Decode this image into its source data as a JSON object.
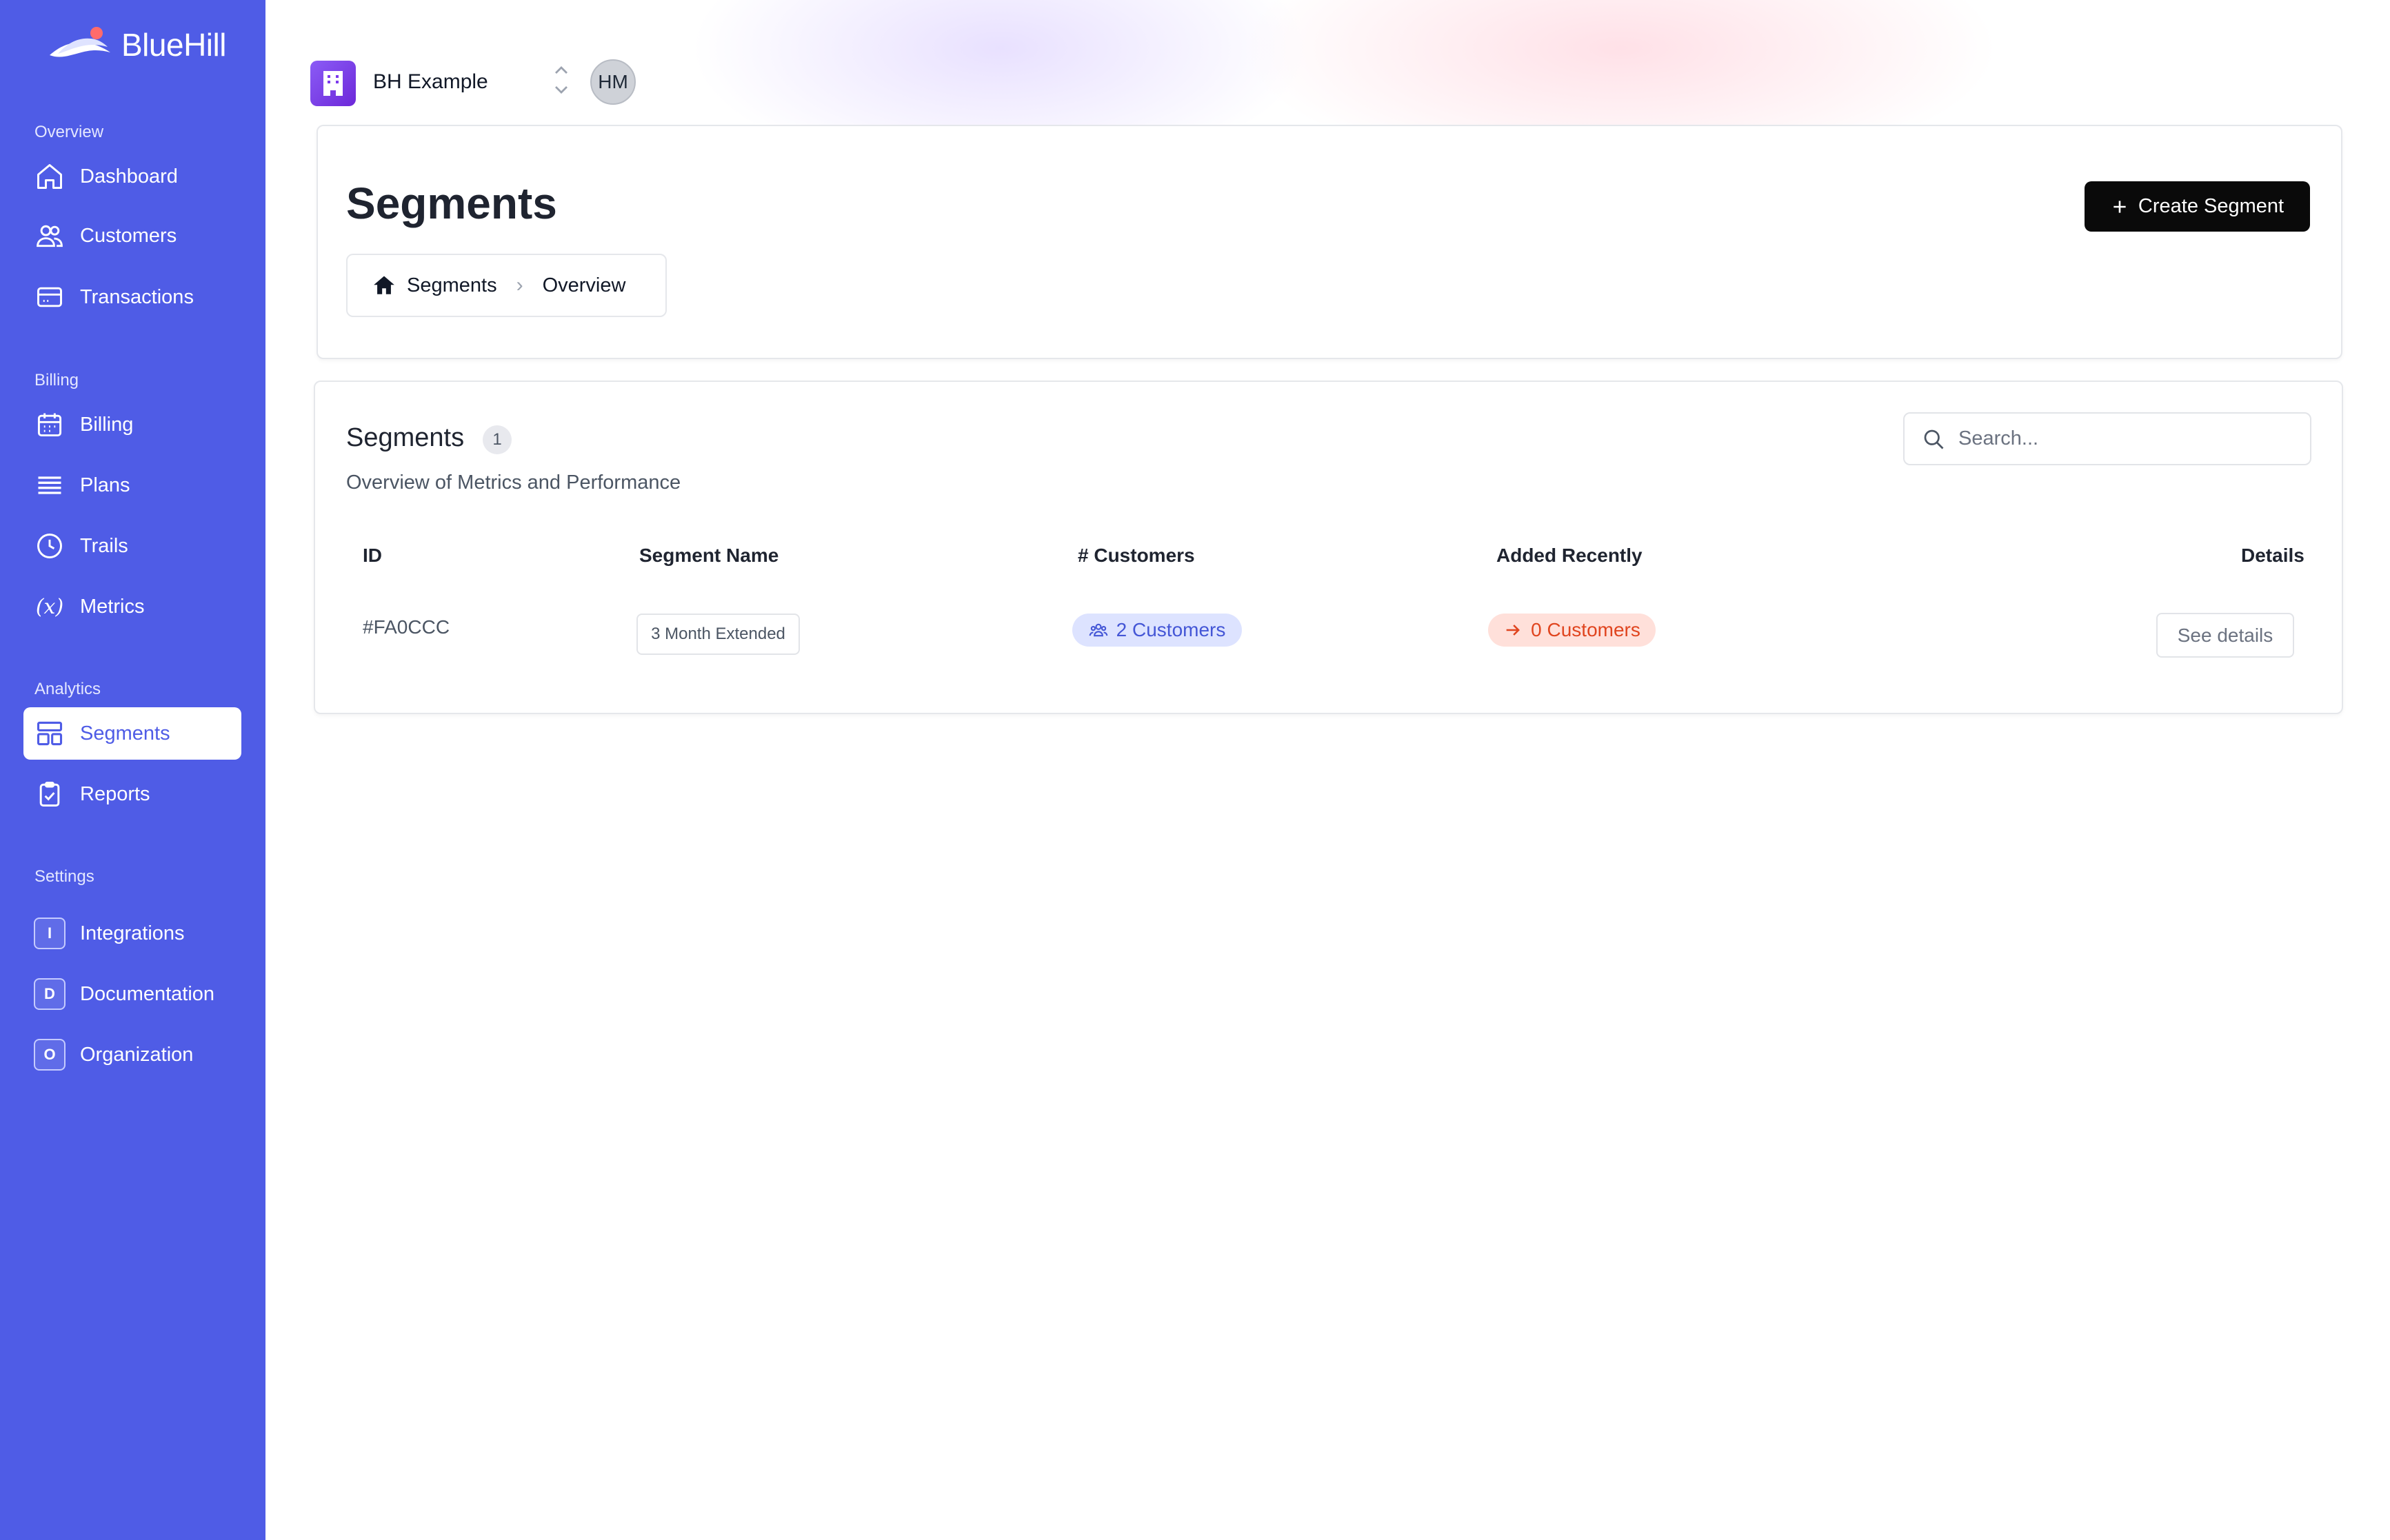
{
  "app": {
    "name": "BlueHill"
  },
  "sidebar": {
    "sections": [
      {
        "label": "Overview"
      },
      {
        "label": "Billing"
      },
      {
        "label": "Analytics"
      },
      {
        "label": "Settings"
      }
    ],
    "items": [
      {
        "label": "Dashboard",
        "icon": "home-icon"
      },
      {
        "label": "Customers",
        "icon": "users-icon"
      },
      {
        "label": "Transactions",
        "icon": "credit-card-icon"
      },
      {
        "label": "Billing",
        "icon": "calendar-icon"
      },
      {
        "label": "Plans",
        "icon": "list-icon"
      },
      {
        "label": "Trails",
        "icon": "clock-icon"
      },
      {
        "label": "Metrics",
        "icon": "function-icon",
        "glyph": "(x)"
      },
      {
        "label": "Segments",
        "icon": "layout-icon",
        "active": true
      },
      {
        "label": "Reports",
        "icon": "clipboard-icon"
      },
      {
        "label": "Integrations",
        "icon": "letter-icon",
        "glyph": "I"
      },
      {
        "label": "Documentation",
        "icon": "letter-icon",
        "glyph": "D"
      },
      {
        "label": "Organization",
        "icon": "letter-icon",
        "glyph": "O"
      }
    ]
  },
  "header": {
    "org_name": "BH Example",
    "avatar_initials": "HM"
  },
  "page": {
    "title": "Segments",
    "create_button": "Create Segment",
    "breadcrumb": [
      "Segments",
      "Overview"
    ]
  },
  "table_section": {
    "title": "Segments",
    "count": "1",
    "subtitle": "Overview of Metrics and Performance",
    "search_placeholder": "Search...",
    "columns": [
      "ID",
      "Segment Name",
      "# Customers",
      "Added Recently",
      "Details"
    ],
    "rows": [
      {
        "id": "#FA0CCC",
        "name": "3 Month Extended",
        "customers": "2 Customers",
        "added_recently": "0 Customers",
        "details": "See details"
      }
    ]
  },
  "colors": {
    "sidebar_bg": "#4f5ce6",
    "primary_button": "#0a0a0a",
    "customers_pill": "#dde3ff",
    "added_pill": "#ffe0da"
  }
}
